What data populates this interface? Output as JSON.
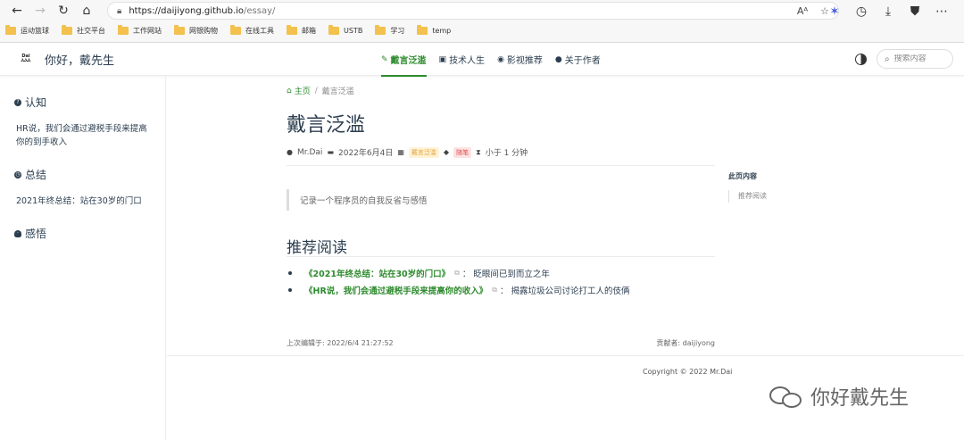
{
  "browser": {
    "url_host": "https://daijiyong.github.io",
    "url_path": "/essay/",
    "bookmarks": [
      "运动篮球",
      "社交平台",
      "工作网站",
      "网银购物",
      "在线工具",
      "邮箱",
      "USTB",
      "学习",
      "temp"
    ]
  },
  "navbar": {
    "logo_text": "Dai",
    "site_name": "你好，戴先生",
    "links": [
      "戴言泛滥",
      "技术人生",
      "影视推荐",
      "关于作者"
    ],
    "active_link": 0,
    "search_placeholder": "搜索内容",
    "accent_color": "#2e8b2e"
  },
  "sidebar": {
    "groups": [
      {
        "title": "认知",
        "items": [
          "HR说，我们会通过避税手段来提高你的到手收入"
        ]
      },
      {
        "title": "总结",
        "items": [
          "2021年终总结：站在30岁的门口"
        ]
      },
      {
        "title": "感悟",
        "items": []
      }
    ]
  },
  "page": {
    "breadcrumb_home": "主页",
    "breadcrumb_sep": "/",
    "breadcrumb_current": "戴言泛滥",
    "title": "戴言泛滥",
    "author": "Mr.Dai",
    "date": "2022年6月4日",
    "category": "戴言泛滥",
    "tag": "随笔",
    "read_time": "小于 1 分钟",
    "quote": "记录一个程序员的自我反省与感悟",
    "section_heading": "推荐阅读",
    "recommendations": [
      {
        "link": "《2021年终总结：站在30岁的门口》",
        "desc": "：  眨眼间已到而立之年"
      },
      {
        "link": "《HR说，我们会通过避税手段来提高你的收入》",
        "desc": "：  揭露垃圾公司讨论打工人的伎俩"
      }
    ],
    "last_edited": "上次编辑于: 2022/6/4 21:27:52",
    "contributors": "贡献者: daijiyong",
    "copyright": "Copyright © 2022 Mr.Dai"
  },
  "toc": {
    "title": "此页内容",
    "items": [
      "推荐阅读"
    ]
  },
  "watermark": {
    "text": "你好戴先生"
  }
}
